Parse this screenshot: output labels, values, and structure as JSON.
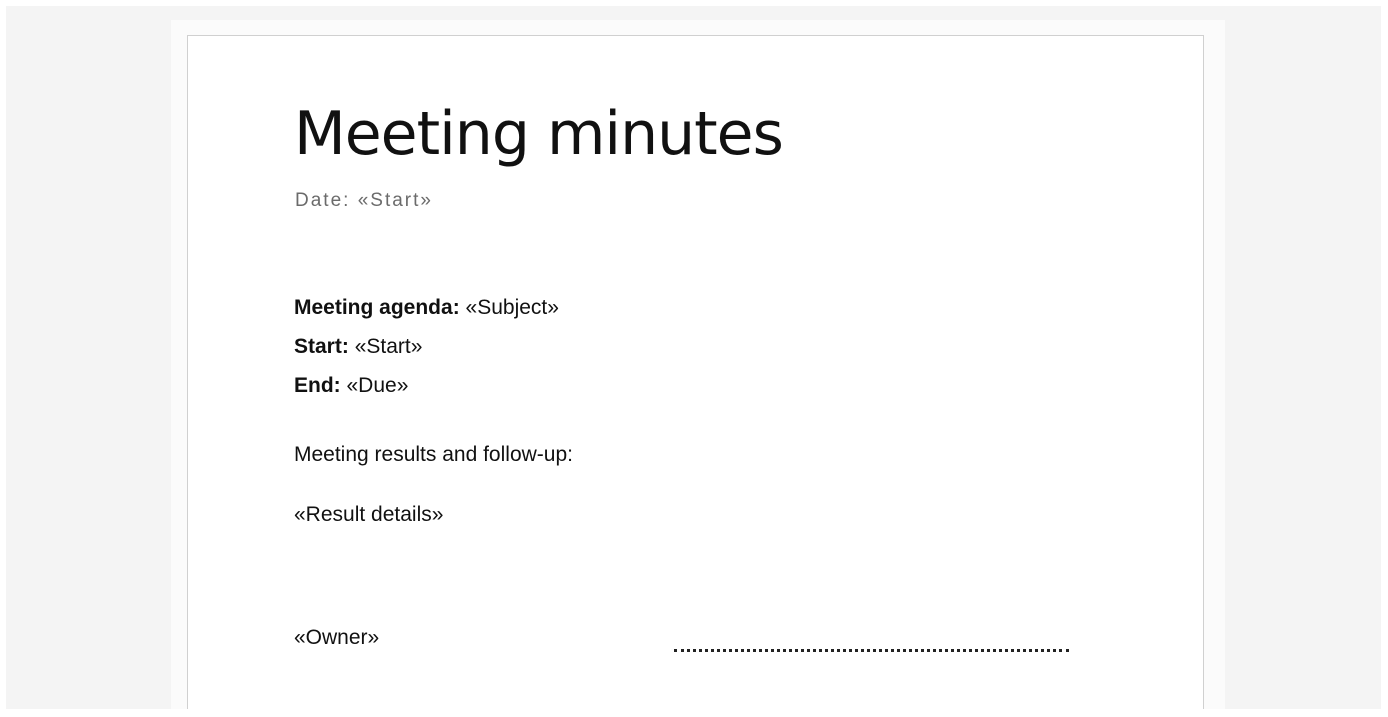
{
  "document": {
    "title": "Meeting minutes",
    "date_label": "Date:",
    "date_value": "«Start»",
    "agenda_label": "Meeting agenda:",
    "agenda_value": "«Subject»",
    "start_label": "Start:",
    "start_value": "«Start»",
    "end_label": "End:",
    "end_value": "«Due»",
    "results_label": "Meeting results and follow-up:",
    "results_details": "«Result details»",
    "owner": "«Owner»"
  }
}
